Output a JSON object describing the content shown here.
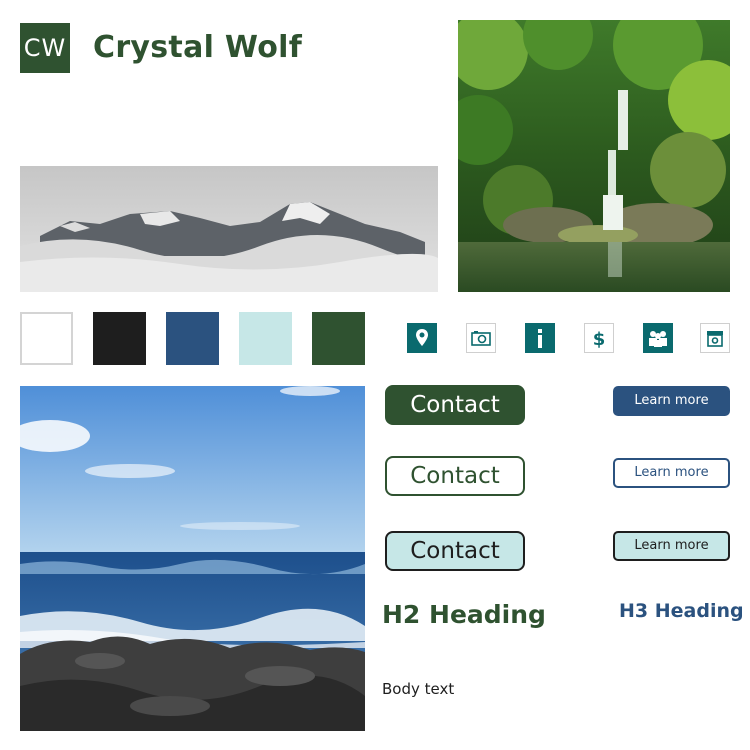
{
  "brand": {
    "initials": "CW",
    "name": "Crystal Wolf"
  },
  "palette": {
    "swatches": [
      "#ffffff",
      "#1e1e1e",
      "#2b527f",
      "#c6e7e7",
      "#2f5230"
    ]
  },
  "icons": [
    "location-pin-icon",
    "camera-icon",
    "info-icon",
    "dollar-icon",
    "group-icon",
    "register-icon"
  ],
  "buttons": {
    "contact_primary": "Contact",
    "contact_outline": "Contact",
    "contact_light": "Contact",
    "learn_primary": "Learn more",
    "learn_outline": "Learn more",
    "learn_light": "Learn more"
  },
  "typography": {
    "h2": "H2 Heading",
    "h3": "H3 Heading",
    "body": "Body text"
  }
}
